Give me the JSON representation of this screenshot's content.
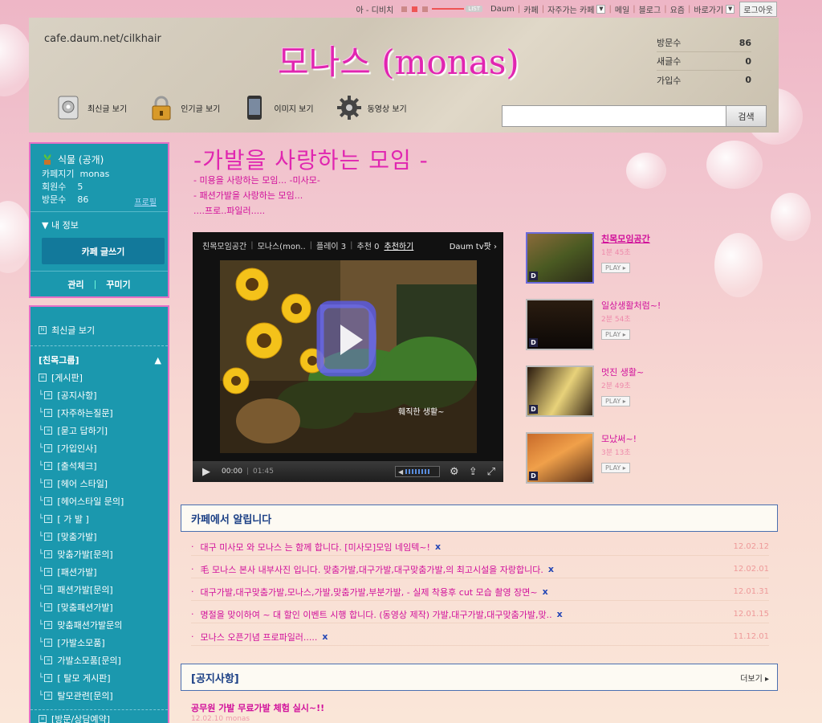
{
  "topbar": {
    "player_label": "아 - 디비치",
    "list_label": "LIST",
    "links": [
      "Daum",
      "카페",
      "자주가는 카페",
      "메일",
      "블로그",
      "요즘",
      "바로가기"
    ],
    "logout": "로그아웃"
  },
  "header": {
    "url": "cafe.daum.net/cilkhair",
    "title": "모나스 (monas)",
    "stats": [
      {
        "label": "방문수",
        "value": "86"
      },
      {
        "label": "새글수",
        "value": "0"
      },
      {
        "label": "가입수",
        "value": "0"
      }
    ],
    "nav": [
      "최신글 보기",
      "인기글 보기",
      "이미지 보기",
      "동영상 보기"
    ],
    "search_button": "검색"
  },
  "cafeinfo": {
    "category": "식물 (공개)",
    "manager_label": "카페지기",
    "manager": "monas",
    "members_label": "회원수",
    "members": "5",
    "visits_label": "방문수",
    "visits": "86",
    "profile": "프로필",
    "my_info": "▼ 내 정보",
    "write": "카페 글쓰기",
    "manage": "관리",
    "decorate": "꾸미기"
  },
  "menu": {
    "recent": "최신글 보기",
    "group": "[친목그룹]",
    "items": [
      {
        "label": "[게시판]",
        "level": 0
      },
      {
        "label": "[공지사항]",
        "level": 1
      },
      {
        "label": "[자주하는질문]",
        "level": 1
      },
      {
        "label": "[묻고 답하기]",
        "level": 1
      },
      {
        "label": "[가입인사]",
        "level": 1
      },
      {
        "label": "[출석체크]",
        "level": 1
      },
      {
        "label": "[헤어 스타일]",
        "level": 1
      },
      {
        "label": "[헤어스타일 문의]",
        "level": 1
      },
      {
        "label": "[ 가 발 ]",
        "level": 1
      },
      {
        "label": "[맞춤가발]",
        "level": 1
      },
      {
        "label": "맞춤가발[문의]",
        "level": 1
      },
      {
        "label": "[패션가발]",
        "level": 1
      },
      {
        "label": "패션가발[문의]",
        "level": 1
      },
      {
        "label": "[맞춤패션가발]",
        "level": 1
      },
      {
        "label": "맞춤패션가발문의",
        "level": 1
      },
      {
        "label": "[가발소모품]",
        "level": 1
      },
      {
        "label": "가발소모품[문의]",
        "level": 1
      },
      {
        "label": "[ 탈모 게시판]",
        "level": 1
      },
      {
        "label": "탈모관련[문의]",
        "level": 1
      },
      {
        "label": "[방문/상담예약]",
        "level": 0
      }
    ]
  },
  "main": {
    "title": "-가발을 사랑하는 모임 -",
    "intro": [
      "- 미용을 사랑하는 모임... -미사모-",
      "- 패션가발을 사랑하는 모임...",
      "....프로..파일러....."
    ]
  },
  "player": {
    "segments": [
      "친목모임공간",
      "모나스(mon..",
      "플레이 3",
      "추천 0"
    ],
    "recommend": "추천하기",
    "daumtv": "Daum tv팟 ›",
    "caption": "훼직한 생활~",
    "current_time": "00:00",
    "duration": "01:45"
  },
  "videos": [
    {
      "title": "친목모임공간",
      "duration": "1분 45초",
      "play": "PLAY ▸",
      "selected": true
    },
    {
      "title": "일상생활처럼~!",
      "duration": "2분 54초",
      "play": "PLAY ▸",
      "selected": false
    },
    {
      "title": "멋진 생활~",
      "duration": "2분 49초",
      "play": "PLAY ▸",
      "selected": false
    },
    {
      "title": "모났써~!",
      "duration": "3분 13초",
      "play": "PLAY ▸",
      "selected": false
    }
  ],
  "announce": {
    "heading": "카페에서 알립니다",
    "items": [
      {
        "text": "대구 미사모 와 모나스 는 함께 합니다. [미사모]모임 네임텍~!",
        "date": "12.02.12"
      },
      {
        "text": "毛 모나스 본사 내부사진 입니다. 맞춤가발,대구가발,대구맞춤가발,의 최고시설을 자랑합니다.",
        "date": "12.02.01"
      },
      {
        "text": "대구가발,대구맞춤가발,모나스,가발,맞춤가발,부분가발, - 실제 착용후 cut 모습 촬영 장면~",
        "date": "12.01.31"
      },
      {
        "text": "명절을 맞이하여 ~ 대 할인 이벤트 시행 합니다. (동영상 제작) 가발,대구가발,대구맞춤가발,맞..",
        "date": "12.01.15"
      },
      {
        "text": "모나스 오픈기념 프로파일러.....",
        "date": "11.12.01"
      }
    ],
    "x": "x"
  },
  "notices": {
    "heading": "[공지사항]",
    "more": "더보기 ▸",
    "post_title": "공무원 가발 무료가발 체험 실시~!!",
    "post_meta": "12.02.10  monas"
  },
  "colors": {
    "accent": "#e026b0",
    "sidebar": "#1b98ae",
    "border": "#e36fc6",
    "link": "#d1109b"
  }
}
